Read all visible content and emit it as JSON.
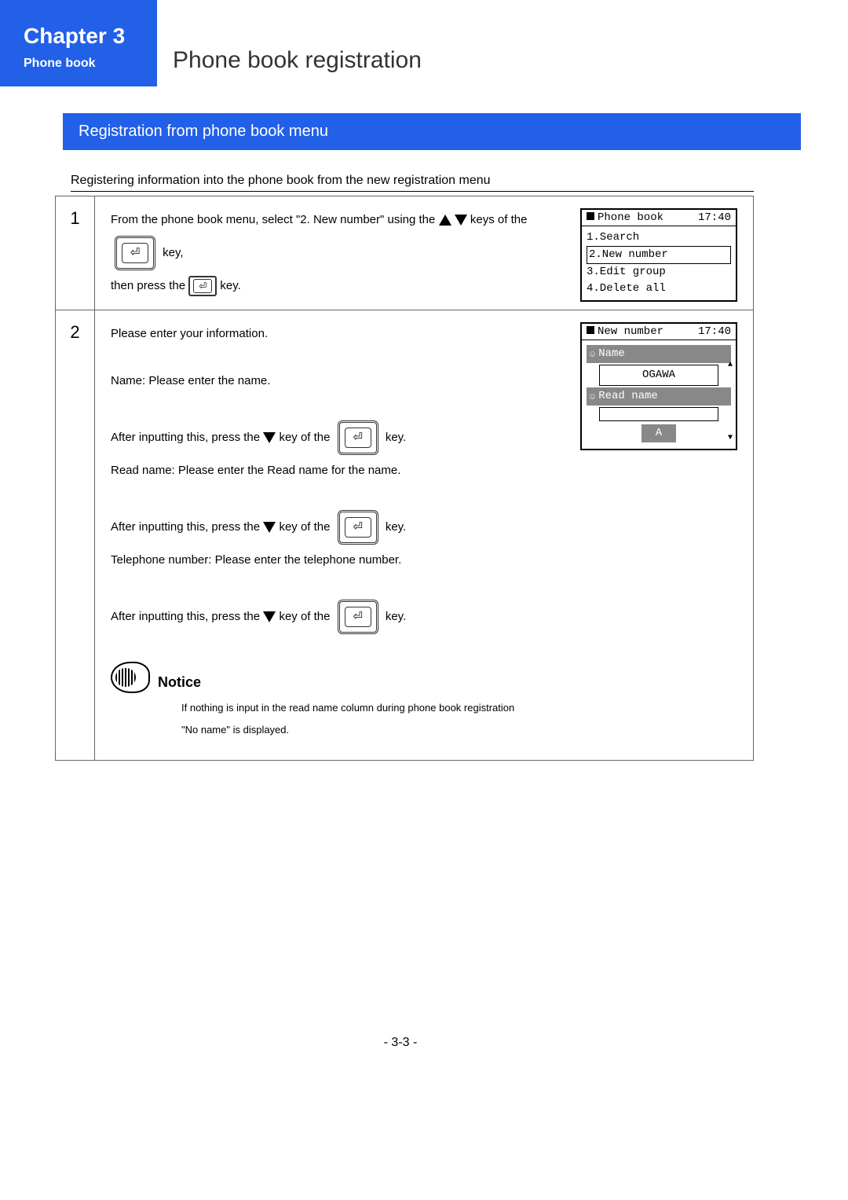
{
  "chapter": {
    "title": "Chapter 3",
    "sub": "Phone book"
  },
  "mainTitle": "Phone book registration",
  "sectionBar": "Registration from phone book menu",
  "intro": "Registering information into the phone book from the new registration menu",
  "step1": {
    "num": "1",
    "text1a": "From the phone book menu, select \"2. New number\" using the ",
    "text1b": " keys of the",
    "key": " key,",
    "text2a": "then press the ",
    "text2b": " key."
  },
  "screen1": {
    "title": "Phone book",
    "time": "17:40",
    "items": [
      "1.Search",
      "2.New number",
      "3.Edit group",
      "4.Delete all"
    ]
  },
  "step2": {
    "num": "2",
    "intro": "Please enter your information.",
    "nameLabel": "Name:  Please enter the name.",
    "afterA": "After inputting this, press the",
    "afterB": " key of the ",
    "afterC": " key.",
    "readLabel": "Read name:  Please enter the Read name for the name.",
    "telLabel": "Telephone number:  Please enter the telephone number."
  },
  "screen2": {
    "title": "New number",
    "time": "17:40",
    "f1": "Name",
    "v1": "OGAWA",
    "f2": "Read name",
    "v2": "",
    "indicator": "A"
  },
  "notice": {
    "title": "Notice",
    "line1": "If nothing is input in the read name column during phone book registration",
    "line2": "\"No name\" is displayed."
  },
  "pageNum": "- 3-3 -"
}
